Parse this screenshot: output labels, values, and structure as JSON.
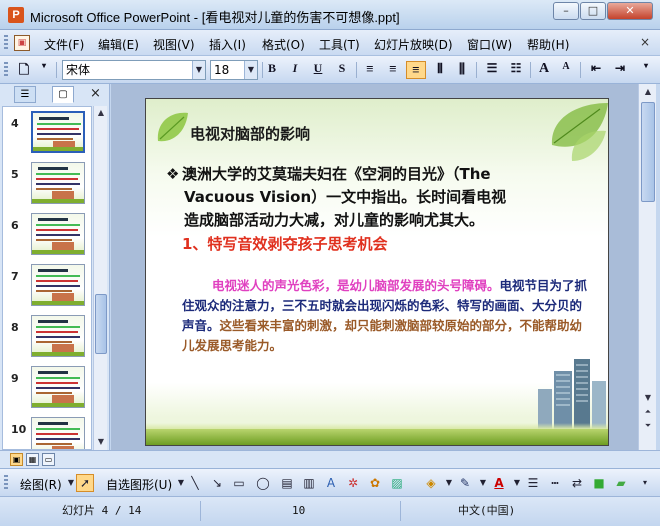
{
  "window": {
    "title": "Microsoft Office PowerPoint - [看电视对儿童的伤害不可想像.ppt]",
    "app_icon": "powerpoint-icon",
    "buttons": {
      "minimize": "–",
      "maximize": "□",
      "close": "✕"
    }
  },
  "menubar": {
    "items": [
      "文件(F)",
      "编辑(E)",
      "视图(V)",
      "插入(I)",
      "格式(O)",
      "工具(T)",
      "幻灯片放映(D)",
      "窗口(W)",
      "帮助(H)"
    ],
    "close_glyph": "×"
  },
  "format_toolbar": {
    "font_name": "宋体",
    "font_size": "18",
    "bold": "B",
    "italic": "I",
    "underline": "U",
    "shadow": "S",
    "grow_font": "A",
    "shrink_font": "A",
    "active_alignment": "align-right"
  },
  "left_pane": {
    "tabs": [
      "outline-tab",
      "slides-tab"
    ],
    "selected_tab": "slides-tab",
    "close_glyph": "×",
    "thumbnails": [
      {
        "number": "4",
        "selected": true
      },
      {
        "number": "5",
        "selected": false
      },
      {
        "number": "6",
        "selected": false
      },
      {
        "number": "7",
        "selected": false
      },
      {
        "number": "8",
        "selected": false
      },
      {
        "number": "9",
        "selected": false
      },
      {
        "number": "10",
        "selected": false
      }
    ]
  },
  "slide": {
    "title": "电视对脑部的影响",
    "bullet_symbol": "❖",
    "bullet_line1": "澳洲大学的艾莫瑞夫妇在《空洞的目光》（The",
    "bullet_line2": "Vacuous Vision）一文中指出。长时间看电视",
    "bullet_line3": "造成脑部活动力大减，对儿童的影响尤其大。",
    "sub_heading": "1、特写音效剥夺孩子思考机会",
    "para_part1": "电视迷人的声光色彩，是幼儿脑部发展的头号障碍。",
    "para_part2": "电视节目为了抓住观众的注意力，三不五时就会出现闪烁的色彩、特写的画面、大分贝的声音。",
    "para_part3": "这些看来丰富的刺激，却只能刺激脑部较原始的部分，不能帮助幼儿发展思考能力。",
    "colors": {
      "title": "#1a1a1a",
      "sub_heading": "#e0301e",
      "para1": "#e040c0",
      "para2": "#1c2a7a",
      "para3": "#9a5a28"
    }
  },
  "drawing_toolbar": {
    "draw_label": "绘图(R)",
    "autoshapes_label": "自选图形(U)"
  },
  "statusbar": {
    "slide_info": "幻灯片 4 / 14",
    "design": "10",
    "language": "中文(中国)"
  }
}
